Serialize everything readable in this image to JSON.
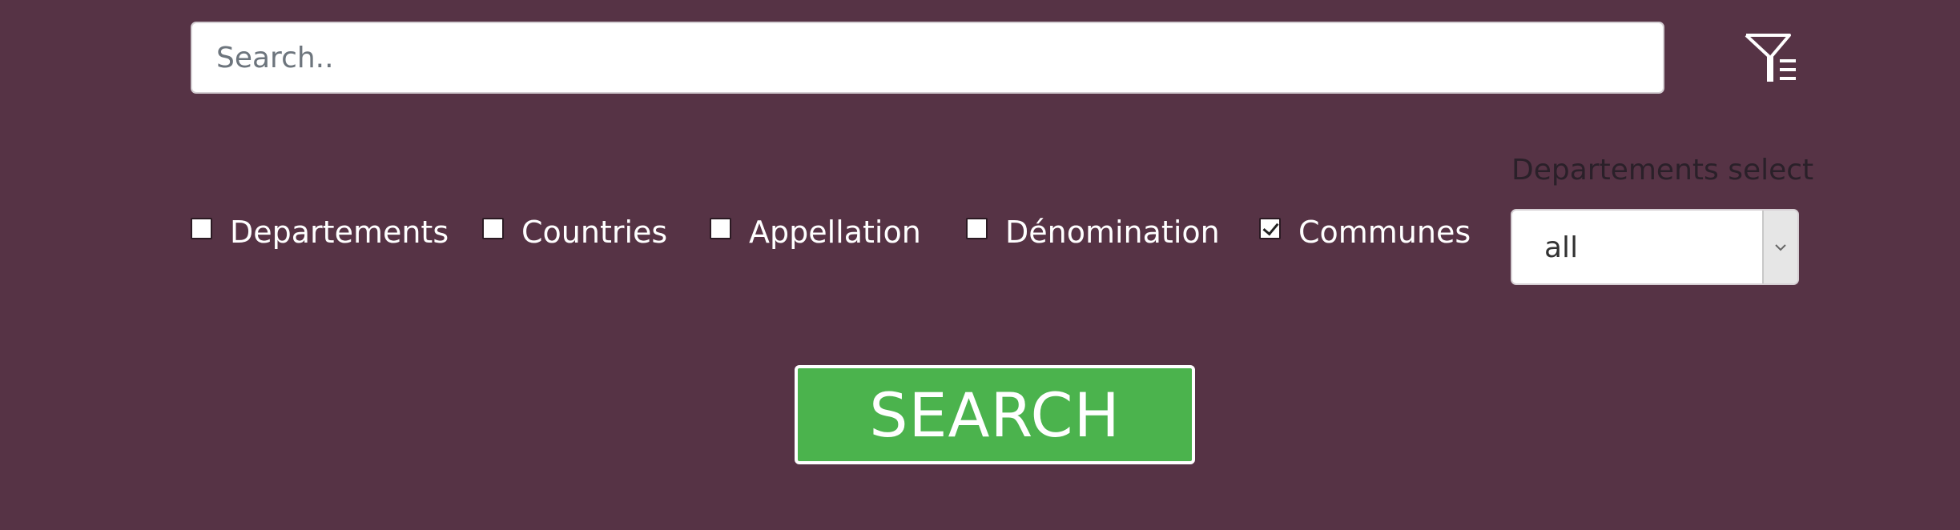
{
  "search": {
    "placeholder": "Search..",
    "value": ""
  },
  "filter_toggle": {
    "icon": "filter-list-icon"
  },
  "categories": [
    {
      "label": "Departements",
      "checked": false
    },
    {
      "label": "Countries",
      "checked": false
    },
    {
      "label": "Appellation",
      "checked": false
    },
    {
      "label": "Dénomination",
      "checked": false
    },
    {
      "label": "Communes",
      "checked": true
    }
  ],
  "departements_select": {
    "label": "Departements select",
    "selected": "all"
  },
  "search_button": {
    "label": "SEARCH"
  },
  "colors": {
    "background": "#563345",
    "button": "#4bb34d"
  }
}
